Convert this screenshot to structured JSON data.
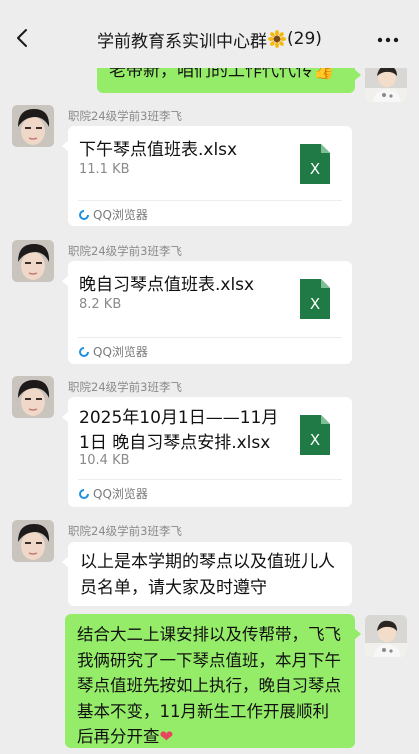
{
  "header": {
    "title": "学前教育系实训中心群",
    "member_count": "(29)"
  },
  "messages": {
    "top_partial": "老带新，咱们的工作代代传",
    "sender_name": "职院24级学前3班李飞",
    "file1": {
      "name": "下午琴点值班表.xlsx",
      "size": "11.1 KB",
      "source": "QQ浏览器"
    },
    "file2": {
      "name": "晚自习琴点值班表.xlsx",
      "size": "8.2 KB",
      "source": "QQ浏览器"
    },
    "file3": {
      "name": "2025年10月1日——11月1日  晚自习琴点安排.xlsx",
      "size": "10.4 KB",
      "source": "QQ浏览器"
    },
    "text_msg": "以上是本学期的琴点以及值班儿人员名单，请大家及时遵守",
    "my_msg": "结合大二上课安排以及传帮带，飞飞我俩研究了一下琴点值班，本月下午琴点值班先按如上执行，晚自习琴点基本不变，11月新生工作开展顺利后再分开查"
  },
  "icons": {
    "back": "chevron-left-icon",
    "more": "more-dots-icon",
    "excel": "excel-file-icon",
    "browser": "qq-browser-icon",
    "emoji_thumb": "thumbs-up-emoji",
    "emoji_heart": "heart-emoji",
    "emoji_sunflower": "sunflower-emoji"
  },
  "colors": {
    "my_bubble": "#95ec69",
    "excel_green": "#1f7a45",
    "background": "#ededed"
  }
}
